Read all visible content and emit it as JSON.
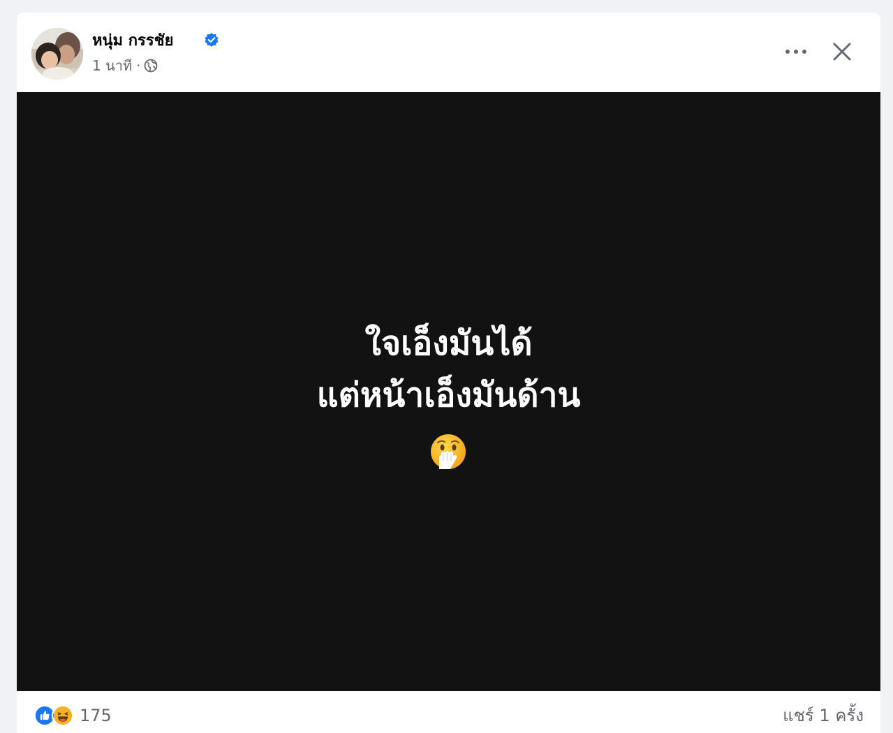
{
  "post": {
    "author_name": "หนุ่ม กรรชัย",
    "timestamp": "1 นาที",
    "meta_separator": "·",
    "privacy_icon": "globe-icon",
    "verified_icon": "verified-badge-icon",
    "actions": {
      "more_icon": "more-options-icon",
      "close_icon": "close-icon"
    },
    "content": {
      "line1": "ใจเอ็งมันได้",
      "line2": "แต่หน้าเอ็งมันด้าน",
      "emoji": "face-with-hand-over-mouth-icon",
      "background_color": "#121212",
      "text_color": "#ffffff"
    },
    "reactions": {
      "icons": [
        "like-icon",
        "haha-icon"
      ],
      "count": "175"
    },
    "shares_label": "แชร์ 1 ครั้ง"
  },
  "colors": {
    "page_background": "#f0f2f5",
    "accent_blue": "#1877f2",
    "secondary_text": "#65676b",
    "primary_text": "#050505"
  }
}
